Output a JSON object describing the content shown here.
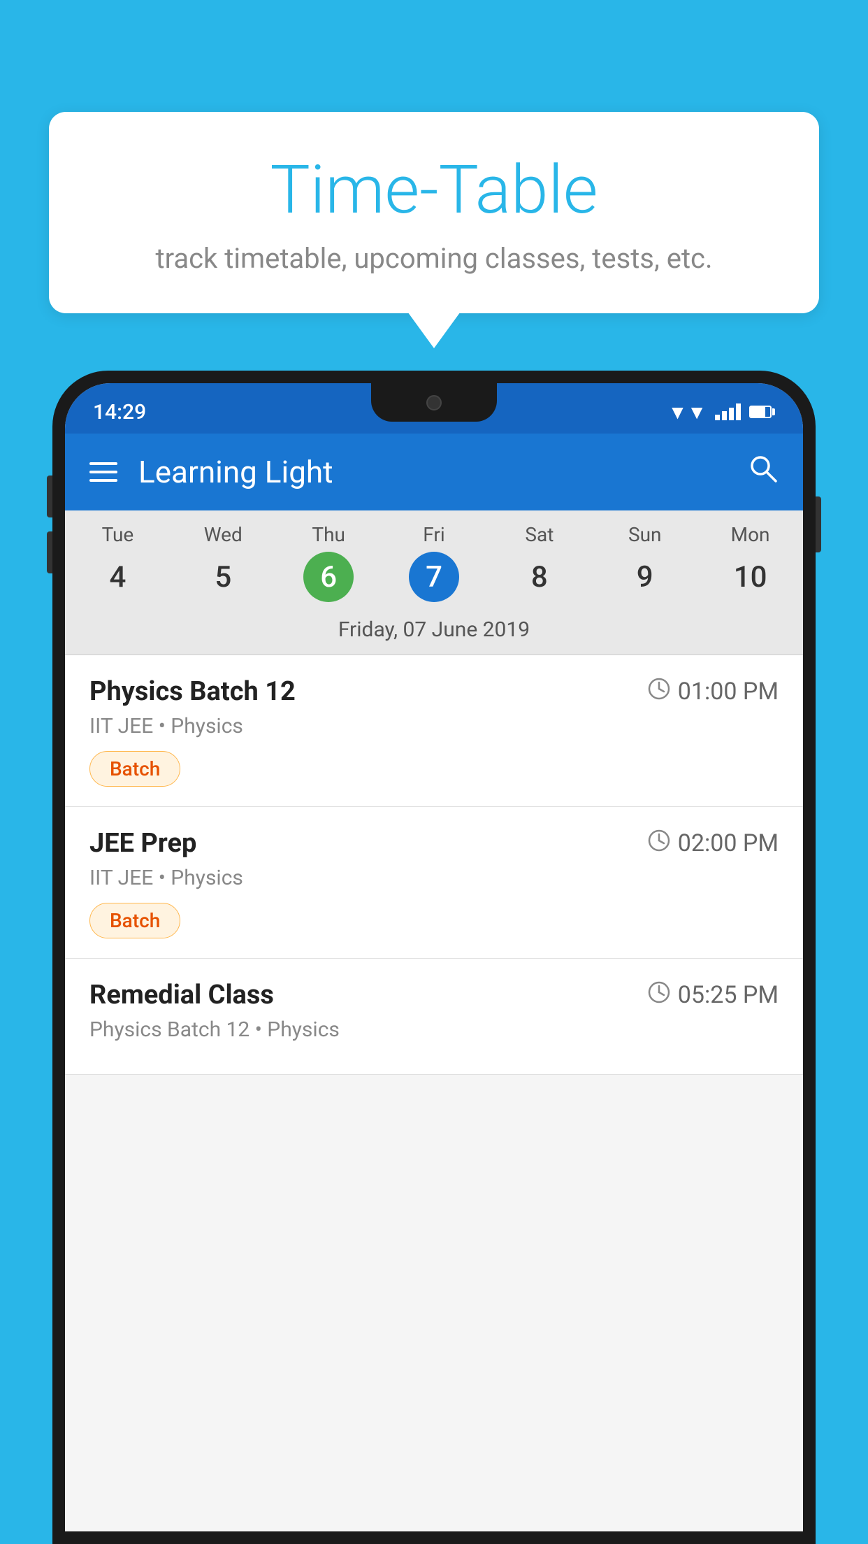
{
  "page": {
    "background_color": "#29B6E8"
  },
  "bubble": {
    "title": "Time-Table",
    "subtitle": "track timetable, upcoming classes, tests, etc."
  },
  "phone": {
    "status_bar": {
      "time": "14:29"
    },
    "app_bar": {
      "title": "Learning Light"
    },
    "calendar": {
      "days": [
        {
          "name": "Tue",
          "num": "4",
          "state": "normal"
        },
        {
          "name": "Wed",
          "num": "5",
          "state": "normal"
        },
        {
          "name": "Thu",
          "num": "6",
          "state": "today"
        },
        {
          "name": "Fri",
          "num": "7",
          "state": "selected"
        },
        {
          "name": "Sat",
          "num": "8",
          "state": "normal"
        },
        {
          "name": "Sun",
          "num": "9",
          "state": "normal"
        },
        {
          "name": "Mon",
          "num": "10",
          "state": "normal"
        }
      ],
      "selected_date_label": "Friday, 07 June 2019"
    },
    "schedule": [
      {
        "title": "Physics Batch 12",
        "time": "01:00 PM",
        "subtitle": "IIT JEE • Physics",
        "badge": "Batch"
      },
      {
        "title": "JEE Prep",
        "time": "02:00 PM",
        "subtitle": "IIT JEE • Physics",
        "badge": "Batch"
      },
      {
        "title": "Remedial Class",
        "time": "05:25 PM",
        "subtitle": "Physics Batch 12 • Physics",
        "badge": ""
      }
    ]
  }
}
